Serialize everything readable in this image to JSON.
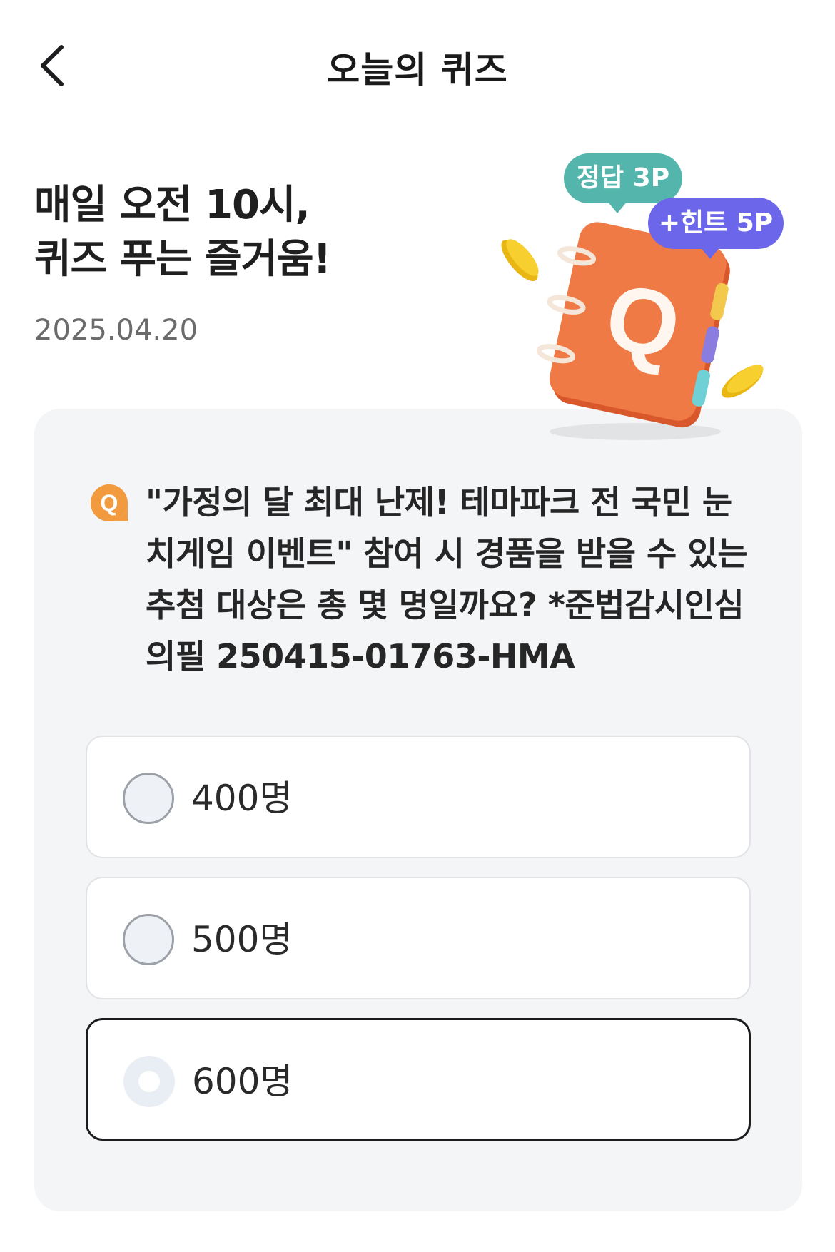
{
  "header": {
    "title": "오늘의 퀴즈",
    "back_icon": "chevron-left-icon"
  },
  "hero": {
    "line1": "매일 오전 10시,",
    "line2": "퀴즈 푸는 즐거움!",
    "date": "2025.04.20"
  },
  "illustration": {
    "answer_points": "정답 3P",
    "hint_points": "+힌트 5P",
    "notebook_letter": "Q"
  },
  "quiz": {
    "badge": "Q",
    "question_lines": [
      "\"가정의 달 최대 난제! 테마파크 전 국민 눈",
      "치게임 이벤트\" 참여 시 경품을 받을 수 있는",
      "추첨 대상은 총 몇 명일까요? *준법감시인심",
      "의필 250415-01763-HMA"
    ],
    "options": [
      {
        "label": "400명",
        "selected": false
      },
      {
        "label": "500명",
        "selected": false
      },
      {
        "label": "600명",
        "selected": true
      }
    ]
  },
  "colors": {
    "badge_orange": "#f19a3e",
    "bubble_teal": "#54b5ac",
    "bubble_purple": "#6c67ea",
    "notebook_orange": "#f07a45",
    "card_bg": "#f4f5f7"
  }
}
